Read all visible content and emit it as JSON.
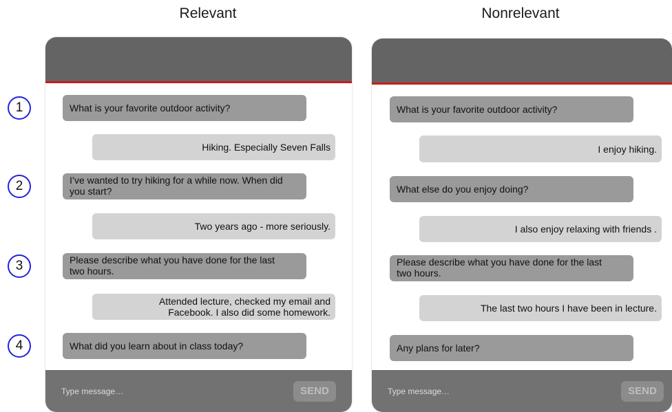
{
  "panels": [
    {
      "title": "Relevant",
      "messages": [
        {
          "role": "question",
          "text": "What is your favorite outdoor activity?"
        },
        {
          "role": "answer",
          "text": "Hiking. Especially Seven Falls"
        },
        {
          "role": "question",
          "text": "I’ve wanted to try hiking for a while now. When did you start?"
        },
        {
          "role": "answer",
          "text": "Two years ago - more seriously."
        },
        {
          "role": "question",
          "text": "Please describe what you have done for the last two hours."
        },
        {
          "role": "answer",
          "text": "Attended lecture, checked my email and Facebook. I also did some homework."
        },
        {
          "role": "question",
          "text": "What did you learn about in class today?"
        }
      ],
      "input_placeholder": "Type message…",
      "send_label": "SEND"
    },
    {
      "title": "Nonrelevant",
      "messages": [
        {
          "role": "question",
          "text": "What is your favorite outdoor activity?"
        },
        {
          "role": "answer",
          "text": "I enjoy hiking."
        },
        {
          "role": "question",
          "text": "What else do you enjoy doing?"
        },
        {
          "role": "answer",
          "text": "I also enjoy relaxing with friends ."
        },
        {
          "role": "question",
          "text": "Please describe what you have done for the last two hours."
        },
        {
          "role": "answer",
          "text": "The last two hours I have been in lecture."
        },
        {
          "role": "question",
          "text": "Any plans for later?"
        }
      ],
      "input_placeholder": "Type message…",
      "send_label": "SEND"
    }
  ],
  "step_markers": [
    "1",
    "2",
    "3",
    "4"
  ],
  "colors": {
    "header": "#646464",
    "header_accent": "#cc1a1a",
    "footer": "#727272",
    "question_bubble": "#9a9a9a",
    "answer_bubble": "#d3d3d3",
    "marker_outline": "#2222dd"
  }
}
